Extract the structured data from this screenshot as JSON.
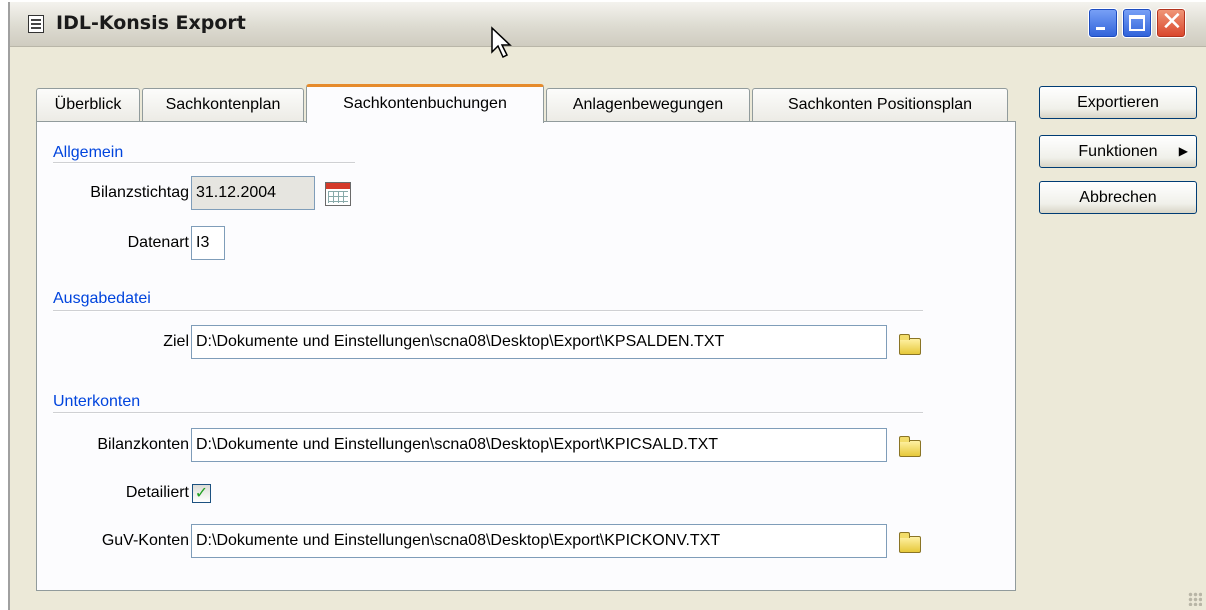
{
  "window": {
    "title": "IDL-Konsis Export",
    "icon": "app-document-icon",
    "controls": [
      "minimize-icon",
      "maximize-icon",
      "close-icon"
    ]
  },
  "tabs": [
    {
      "label": "Überblick",
      "active": false
    },
    {
      "label": "Sachkontenplan",
      "active": false
    },
    {
      "label": "Sachkontenbuchungen",
      "active": true
    },
    {
      "label": "Anlagenbewegungen",
      "active": false
    },
    {
      "label": "Sachkonten Positionsplan",
      "active": false
    }
  ],
  "sections": {
    "allgemein": {
      "title": "Allgemein",
      "bilanzstichtag_label": "Bilanzstichtag",
      "bilanzstichtag_value": "31.12.2004",
      "datenart_label": "Datenart",
      "datenart_value": "I3"
    },
    "ausgabedatei": {
      "title": "Ausgabedatei",
      "ziel_label": "Ziel",
      "ziel_value": "D:\\Dokumente und Einstellungen\\scna08\\Desktop\\Export\\KPSALDEN.TXT"
    },
    "unterkonten": {
      "title": "Unterkonten",
      "bilanzkonten_label": "Bilanzkonten",
      "bilanzkonten_value": "D:\\Dokumente und Einstellungen\\scna08\\Desktop\\Export\\KPICSALD.TXT",
      "detailiert_label": "Detailiert",
      "detailiert_checked": true,
      "guv_label": "GuV-Konten",
      "guv_value": "D:\\Dokumente und Einstellungen\\scna08\\Desktop\\Export\\KPICKONV.TXT"
    }
  },
  "buttons": {
    "exportieren": "Exportieren",
    "funktionen": "Funktionen",
    "abbrechen": "Abbrechen"
  },
  "colors": {
    "section_title": "#0044dd",
    "active_tab_accent": "#e68b2c",
    "window_bg": "#ece9d8"
  }
}
